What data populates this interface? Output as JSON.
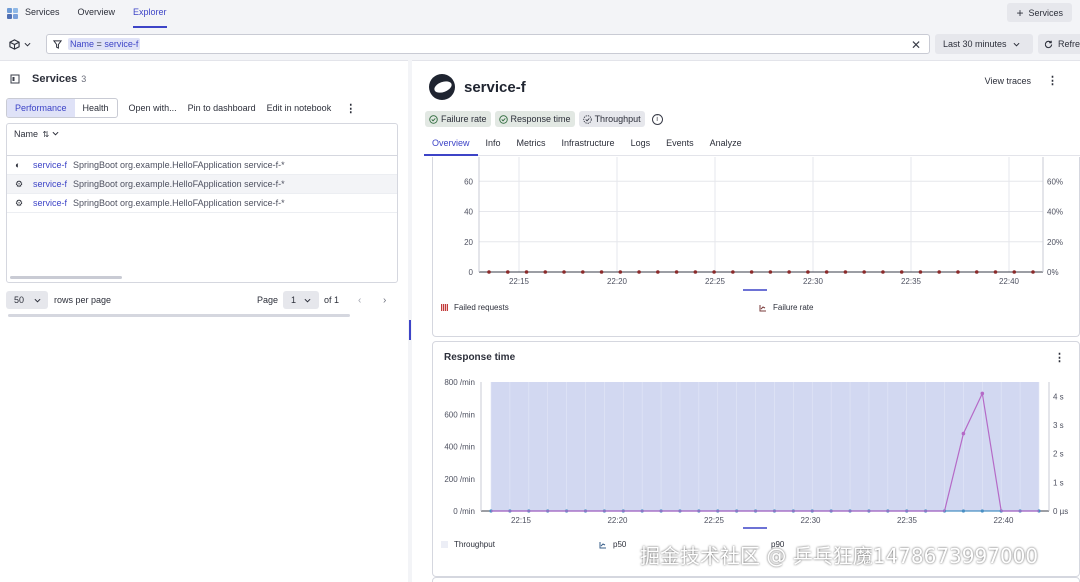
{
  "topnav": {
    "items": [
      "Services",
      "Overview",
      "Explorer"
    ],
    "services_button": "Services"
  },
  "filter": {
    "key": "Name",
    "op": "=",
    "value": "service-f",
    "time_range": "Last 30 minutes",
    "refresh": "Refre"
  },
  "left": {
    "title": "Services",
    "count": "3",
    "segments": [
      "Performance",
      "Health"
    ],
    "toolbar": [
      "Open with...",
      "Pin to dashboard",
      "Edit in notebook"
    ],
    "column": "Name",
    "rows": [
      {
        "name": "service-f",
        "desc": "SpringBoot org.example.HelloFApplication service-f-*"
      },
      {
        "name": "service-f",
        "desc": "SpringBoot org.example.HelloFApplication service-f-*"
      },
      {
        "name": "service-f",
        "desc": "SpringBoot org.example.HelloFApplication service-f-*"
      }
    ],
    "rows_per_page": "50",
    "rows_per_page_label": "rows per page",
    "page_label": "Page",
    "page": "1",
    "of_label": "of 1"
  },
  "right": {
    "title": "service-f",
    "view_traces": "View traces",
    "badges": [
      "Failure rate",
      "Response time",
      "Throughput"
    ],
    "tabs": [
      "Overview",
      "Info",
      "Metrics",
      "Infrastructure",
      "Logs",
      "Events",
      "Analyze"
    ],
    "card2_title": "Response time"
  },
  "colors": {
    "accent": "#3d44c7",
    "failed": "#c23b3b",
    "p90": "#b56ac7",
    "throughput_fill": "#cdd4f0",
    "p50": "#4a90c4"
  },
  "chart_data": [
    {
      "type": "bar",
      "title": "",
      "x_ticks": [
        "22:15",
        "22:20",
        "22:25",
        "22:30",
        "22:35",
        "22:40"
      ],
      "y_left_ticks": [
        "0",
        "20",
        "40",
        "60",
        "80"
      ],
      "y_right_ticks": [
        "0%",
        "20%",
        "40%",
        "60%",
        "80%"
      ],
      "ylim": [
        0,
        80
      ],
      "series": [
        {
          "name": "Failed requests",
          "values": [
            0,
            0,
            0,
            0,
            0,
            0,
            0,
            0,
            0,
            0,
            0,
            0,
            0,
            0,
            0,
            0,
            0,
            0,
            0,
            0,
            0,
            0,
            0,
            0,
            0,
            0,
            0,
            0,
            0,
            0
          ]
        },
        {
          "name": "Failure rate",
          "values": [
            0,
            0,
            0,
            0,
            0,
            0,
            0,
            0,
            0,
            0,
            0,
            0,
            0,
            0,
            0,
            0,
            0,
            0,
            0,
            0,
            0,
            0,
            0,
            0,
            0,
            0,
            0,
            0,
            0,
            0
          ]
        }
      ]
    },
    {
      "type": "line",
      "title": "Response time",
      "x_ticks": [
        "22:15",
        "22:20",
        "22:25",
        "22:30",
        "22:35",
        "22:40"
      ],
      "y_left_ticks": [
        "0 /min",
        "200 /min",
        "400 /min",
        "600 /min",
        "800 /min"
      ],
      "y_right_ticks": [
        "0 µs",
        "1 s",
        "2 s",
        "3 s",
        "4 s"
      ],
      "ylim_left": [
        0,
        800
      ],
      "ylim_right": [
        0,
        4.5
      ],
      "series": [
        {
          "name": "Throughput",
          "values": [
            800,
            800,
            800,
            800,
            800,
            800,
            800,
            800,
            800,
            800,
            800,
            800,
            800,
            800,
            800,
            800,
            800,
            800,
            800,
            800,
            800,
            800,
            800,
            800,
            800,
            800,
            800,
            800,
            800,
            800
          ]
        },
        {
          "name": "p50",
          "values": [
            0,
            0,
            0,
            0,
            0,
            0,
            0,
            0,
            0,
            0,
            0,
            0,
            0,
            0,
            0,
            0,
            0,
            0,
            0,
            0,
            0,
            0,
            0,
            0,
            0,
            0,
            0,
            0,
            0,
            0
          ]
        },
        {
          "name": "p90",
          "values": [
            0,
            0,
            0,
            0,
            0,
            0,
            0,
            0,
            0,
            0,
            0,
            0,
            0,
            0,
            0,
            0,
            0,
            0,
            0,
            0,
            0,
            0,
            0,
            0,
            0,
            2.7,
            4.1,
            0,
            0,
            0
          ]
        }
      ]
    }
  ],
  "watermark": "掘金技术社区 @ 乒乓狂魔1478673997000"
}
